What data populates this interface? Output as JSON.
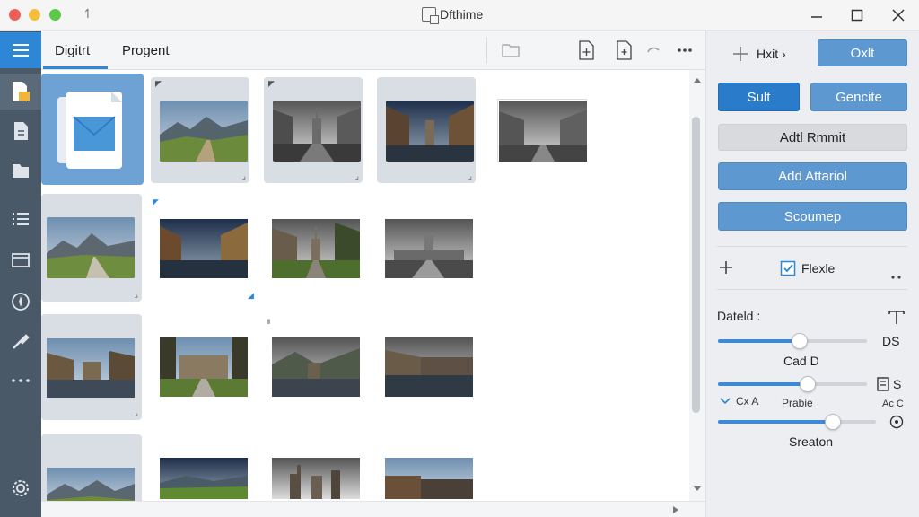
{
  "window": {
    "title": "Dfthime"
  },
  "tabs": [
    {
      "label": "Digitrt"
    },
    {
      "label": "Progent"
    }
  ],
  "panel": {
    "hxit_label": "Hxit ›",
    "oxlt_label": "Oxlt",
    "sult_label": "Sult",
    "gencite_label": "Gencite",
    "adtl_label": "Adtl Rmmit",
    "add_label": "Add Attariol",
    "scoumep_label": "Scoumep",
    "flexle_label": "Flexle",
    "dateld_label": "Dateld :",
    "slider1": {
      "label": "Cad D",
      "value_label": "DS",
      "level": 0.55
    },
    "slider2": {
      "label": "Prabie",
      "left_label": "Cx A",
      "right_label": "Ac C",
      "level": 0.6
    },
    "slider3": {
      "label": "Sreaton",
      "level": 0.73
    }
  },
  "colors": {
    "accent": "#2e86d6",
    "sidebar": "#4a5968",
    "button": "#5e98d0"
  }
}
